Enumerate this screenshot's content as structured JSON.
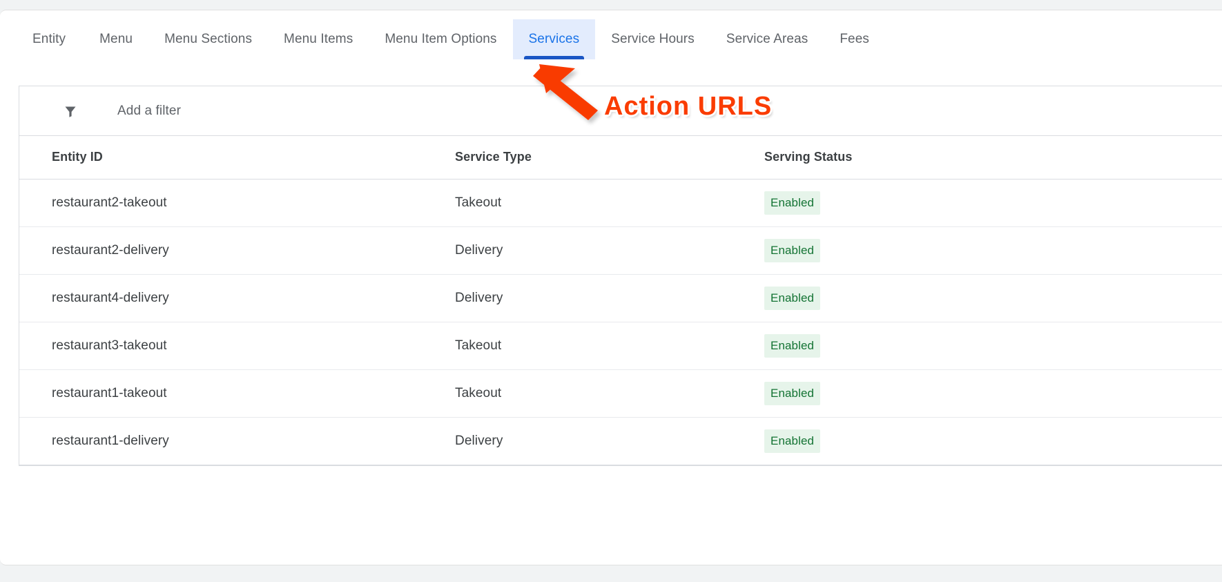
{
  "tabs": [
    {
      "label": "Entity",
      "active": false
    },
    {
      "label": "Menu",
      "active": false
    },
    {
      "label": "Menu Sections",
      "active": false
    },
    {
      "label": "Menu Items",
      "active": false
    },
    {
      "label": "Menu Item Options",
      "active": false
    },
    {
      "label": "Services",
      "active": true
    },
    {
      "label": "Service Hours",
      "active": false
    },
    {
      "label": "Service Areas",
      "active": false
    },
    {
      "label": "Fees",
      "active": false
    }
  ],
  "filter": {
    "icon": "filter-funnel-icon",
    "placeholder": "Add a filter",
    "value": ""
  },
  "table": {
    "columns": [
      "Entity ID",
      "Service Type",
      "Serving Status"
    ],
    "rows": [
      {
        "entity_id": "restaurant2-takeout",
        "service_type": "Takeout",
        "serving_status": "Enabled"
      },
      {
        "entity_id": "restaurant2-delivery",
        "service_type": "Delivery",
        "serving_status": "Enabled"
      },
      {
        "entity_id": "restaurant4-delivery",
        "service_type": "Delivery",
        "serving_status": "Enabled"
      },
      {
        "entity_id": "restaurant3-takeout",
        "service_type": "Takeout",
        "serving_status": "Enabled"
      },
      {
        "entity_id": "restaurant1-takeout",
        "service_type": "Takeout",
        "serving_status": "Enabled"
      },
      {
        "entity_id": "restaurant1-delivery",
        "service_type": "Delivery",
        "serving_status": "Enabled"
      }
    ]
  },
  "annotation": {
    "text": "Action URLS",
    "color": "#fa3c00",
    "arrow": "red-arrow-pointing-to-services-tab"
  },
  "colors": {
    "accent_blue": "#1a73e8",
    "tab_active_bg": "#e3ecfd",
    "tab_underline": "#1a56c4",
    "badge_bg": "#e6f4ea",
    "badge_text": "#137333",
    "page_bg": "#f1f3f4",
    "border": "#dadce0"
  }
}
